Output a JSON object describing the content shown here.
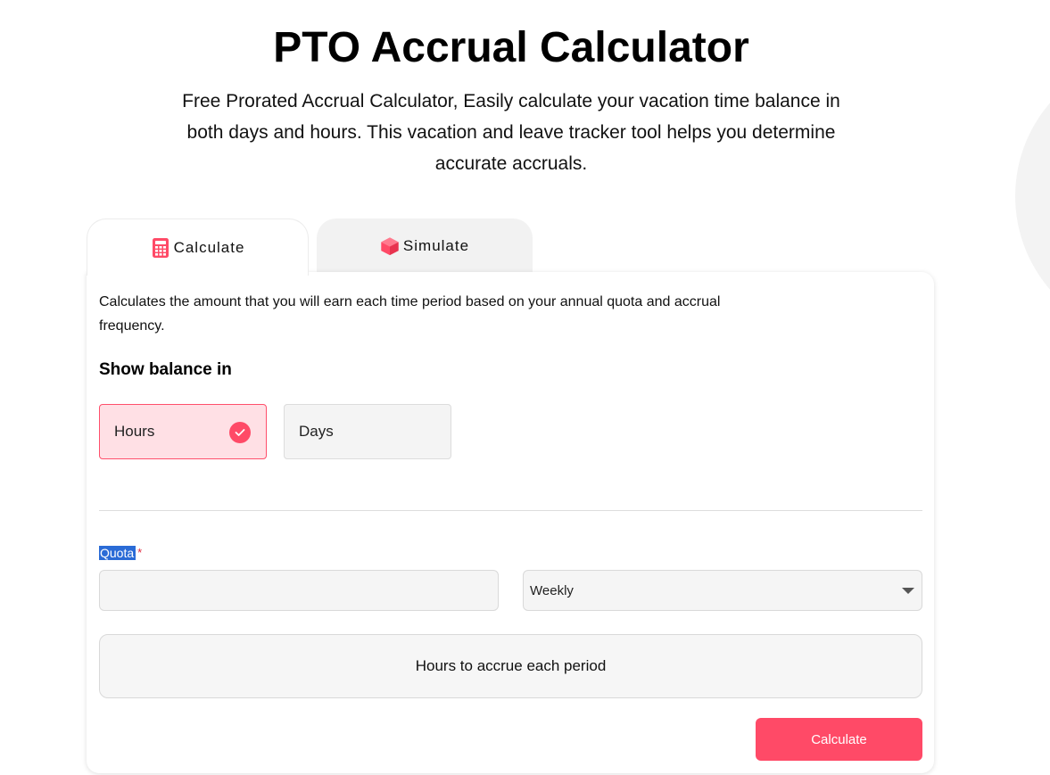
{
  "header": {
    "title": "PTO Accrual Calculator",
    "subtitle": "Free Prorated Accrual Calculator, Easily calculate your vacation time balance in both days and hours. This vacation and leave tracker tool helps you determine accurate accruals."
  },
  "tabs": [
    {
      "label": "Calculate",
      "icon": "calculator-icon",
      "active": true
    },
    {
      "label": "Simulate",
      "icon": "cube-icon",
      "active": false
    }
  ],
  "calculator": {
    "description": "Calculates the amount that you will earn each time period based on your annual quota and accrual frequency.",
    "balance_heading": "Show balance in",
    "options": [
      {
        "label": "Hours",
        "selected": true
      },
      {
        "label": "Days",
        "selected": false
      }
    ],
    "quota_label": "Quota",
    "required_mark": "*",
    "quota_value": "",
    "frequency_selected": "Weekly",
    "result_text": "Hours to accrue each period",
    "calculate_label": "Calculate"
  },
  "colors": {
    "accent": "#ff4a67",
    "selected_bg": "#ffe0e5",
    "field_bg": "#f5f5f5"
  }
}
